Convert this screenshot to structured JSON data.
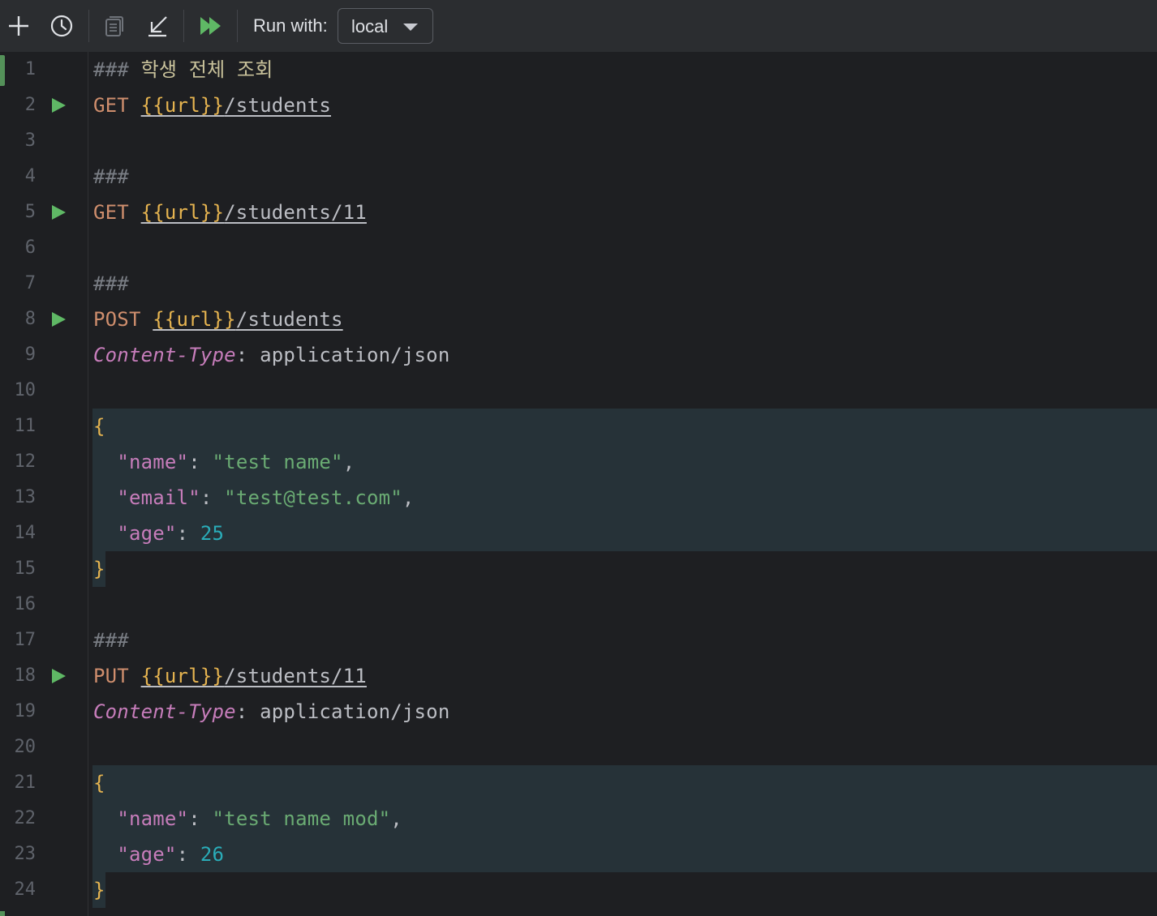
{
  "toolbar": {
    "add_icon": "plus-icon",
    "history_icon": "clock-icon",
    "copy_icon": "copy-icon",
    "import_icon": "import-arrow-icon",
    "run_all_icon": "run-all-icon",
    "run_with_label": "Run with:",
    "environment": "local"
  },
  "editor": {
    "language": "http-request",
    "lines": [
      {
        "n": "1",
        "run": false,
        "tokens": [
          {
            "c": "c-comment",
            "t": "### "
          },
          {
            "c": "c-title",
            "t": "학생 전체 조회"
          }
        ]
      },
      {
        "n": "2",
        "run": true,
        "tokens": [
          {
            "c": "c-method",
            "t": "GET "
          },
          {
            "c": "c-var",
            "t": "{{url}}"
          },
          {
            "c": "c-path",
            "t": "/students"
          }
        ]
      },
      {
        "n": "3",
        "run": false,
        "tokens": []
      },
      {
        "n": "4",
        "run": false,
        "tokens": [
          {
            "c": "c-comment",
            "t": "###"
          }
        ]
      },
      {
        "n": "5",
        "run": true,
        "tokens": [
          {
            "c": "c-method",
            "t": "GET "
          },
          {
            "c": "c-var",
            "t": "{{url}}"
          },
          {
            "c": "c-path",
            "t": "/students/11"
          }
        ]
      },
      {
        "n": "6",
        "run": false,
        "tokens": []
      },
      {
        "n": "7",
        "run": false,
        "tokens": [
          {
            "c": "c-comment",
            "t": "###"
          }
        ]
      },
      {
        "n": "8",
        "run": true,
        "tokens": [
          {
            "c": "c-method",
            "t": "POST "
          },
          {
            "c": "c-var",
            "t": "{{url}}"
          },
          {
            "c": "c-path",
            "t": "/students"
          }
        ]
      },
      {
        "n": "9",
        "run": false,
        "tokens": [
          {
            "c": "c-header",
            "t": "Content-Type"
          },
          {
            "c": "c-plain",
            "t": ": application/json"
          }
        ]
      },
      {
        "n": "10",
        "run": false,
        "tokens": []
      },
      {
        "n": "11",
        "run": false,
        "tokens": [
          {
            "c": "c-brace",
            "t": "{"
          }
        ]
      },
      {
        "n": "12",
        "run": false,
        "tokens": [
          {
            "c": "c-plain",
            "t": "  "
          },
          {
            "c": "c-key",
            "t": "\"name\""
          },
          {
            "c": "c-plain",
            "t": ": "
          },
          {
            "c": "c-str",
            "t": "\"test name\""
          },
          {
            "c": "c-plain",
            "t": ","
          }
        ]
      },
      {
        "n": "13",
        "run": false,
        "tokens": [
          {
            "c": "c-plain",
            "t": "  "
          },
          {
            "c": "c-key",
            "t": "\"email\""
          },
          {
            "c": "c-plain",
            "t": ": "
          },
          {
            "c": "c-str",
            "t": "\"test@test.com\""
          },
          {
            "c": "c-plain",
            "t": ","
          }
        ]
      },
      {
        "n": "14",
        "run": false,
        "tokens": [
          {
            "c": "c-plain",
            "t": "  "
          },
          {
            "c": "c-key",
            "t": "\"age\""
          },
          {
            "c": "c-plain",
            "t": ": "
          },
          {
            "c": "c-num",
            "t": "25"
          }
        ]
      },
      {
        "n": "15",
        "run": false,
        "tokens": [
          {
            "c": "c-brace",
            "t": "}"
          }
        ]
      },
      {
        "n": "16",
        "run": false,
        "tokens": []
      },
      {
        "n": "17",
        "run": false,
        "tokens": [
          {
            "c": "c-comment",
            "t": "###"
          }
        ]
      },
      {
        "n": "18",
        "run": true,
        "tokens": [
          {
            "c": "c-method",
            "t": "PUT "
          },
          {
            "c": "c-var",
            "t": "{{url}}"
          },
          {
            "c": "c-path",
            "t": "/students/11"
          }
        ]
      },
      {
        "n": "19",
        "run": false,
        "tokens": [
          {
            "c": "c-header",
            "t": "Content-Type"
          },
          {
            "c": "c-plain",
            "t": ": application/json"
          }
        ]
      },
      {
        "n": "20",
        "run": false,
        "tokens": []
      },
      {
        "n": "21",
        "run": false,
        "tokens": [
          {
            "c": "c-brace",
            "t": "{"
          }
        ]
      },
      {
        "n": "22",
        "run": false,
        "tokens": [
          {
            "c": "c-plain",
            "t": "  "
          },
          {
            "c": "c-key",
            "t": "\"name\""
          },
          {
            "c": "c-plain",
            "t": ": "
          },
          {
            "c": "c-str",
            "t": "\"test name mod\""
          },
          {
            "c": "c-plain",
            "t": ","
          }
        ]
      },
      {
        "n": "23",
        "run": false,
        "tokens": [
          {
            "c": "c-plain",
            "t": "  "
          },
          {
            "c": "c-key",
            "t": "\"age\""
          },
          {
            "c": "c-plain",
            "t": ": "
          },
          {
            "c": "c-num",
            "t": "26"
          }
        ]
      },
      {
        "n": "24",
        "run": false,
        "tokens": [
          {
            "c": "c-brace",
            "t": "}"
          }
        ]
      }
    ]
  },
  "colors": {
    "background": "#1e1f22",
    "toolbar": "#2b2d30",
    "json_block": "#263238",
    "run_gutter": "#5fb865",
    "change_marker": "#549159"
  }
}
